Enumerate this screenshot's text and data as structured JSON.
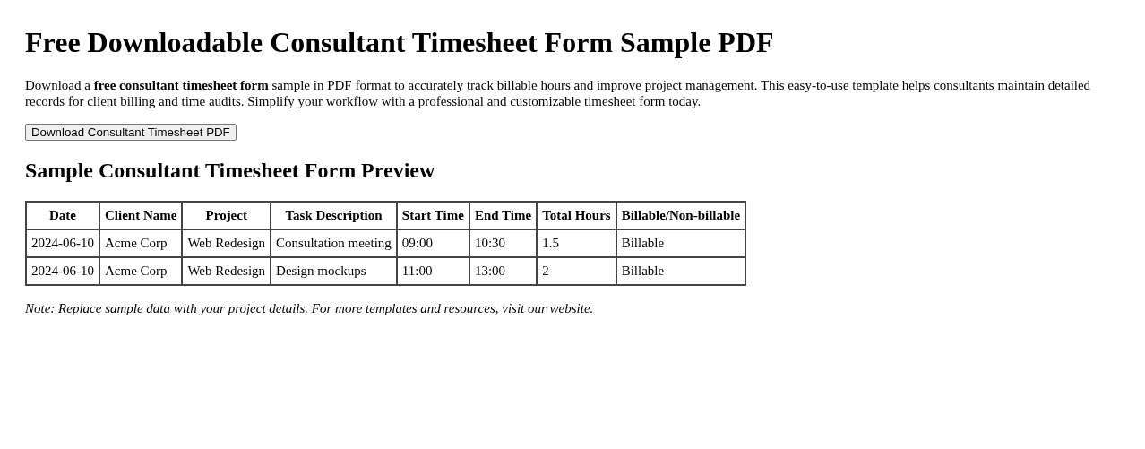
{
  "title": "Free Downloadable Consultant Timesheet Form Sample PDF",
  "intro": "Download a **free consultant timesheet form** sample in PDF format to accurately track billable hours and improve project management. This easy-to-use template helps consultants maintain detailed records for client billing and time audits. Simplify your workflow with a professional and customizable timesheet form today.",
  "download_button": "Download Consultant Timesheet PDF",
  "preview_heading": "Sample Consultant Timesheet Form Preview",
  "table": {
    "columns": [
      "Date",
      "Client Name",
      "Project",
      "Task Description",
      "Start Time",
      "End Time",
      "Total Hours",
      "Billable/Non-billable"
    ],
    "rows": [
      [
        "2024-06-10",
        "Acme Corp",
        "Web Redesign",
        "Consultation meeting",
        "09:00",
        "10:30",
        "1.5",
        "Billable"
      ],
      [
        "2024-06-10",
        "Acme Corp",
        "Web Redesign",
        "Design mockups",
        "11:00",
        "13:00",
        "2",
        "Billable"
      ]
    ]
  },
  "note": "Note: Replace sample data with your project details. For more templates and resources, visit our website."
}
